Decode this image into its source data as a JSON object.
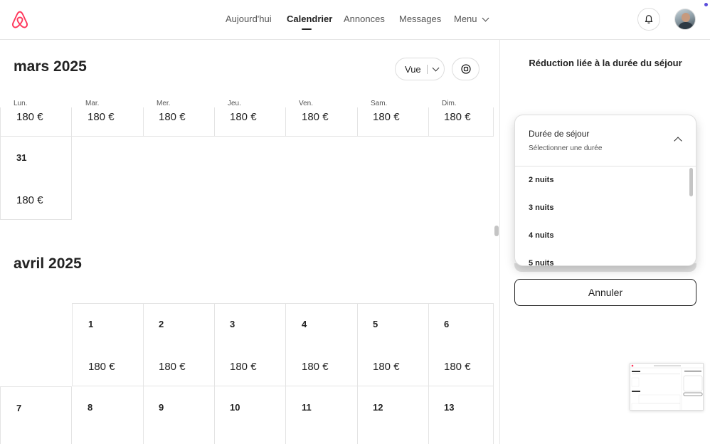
{
  "header": {
    "nav": [
      {
        "label": "Aujourd'hui",
        "active": false
      },
      {
        "label": "Calendrier",
        "active": true
      },
      {
        "label": "Annonces",
        "active": false
      },
      {
        "label": "Messages",
        "active": false
      },
      {
        "label": "Menu",
        "active": false
      }
    ],
    "icons": [
      "airbnb-logo",
      "bell-icon",
      "avatar"
    ],
    "brand_color": "#FF385C"
  },
  "calendar": {
    "controls": {
      "view_label": "Vue"
    },
    "weekdays": [
      "Lun.",
      "Mar.",
      "Mer.",
      "Jeu.",
      "Ven.",
      "Sam.",
      "Dim."
    ],
    "march": {
      "title": "mars 2025",
      "week_prices": [
        "180 €",
        "180 €",
        "180 €",
        "180 €",
        "180 €",
        "180 €",
        "180 €"
      ],
      "last_day": {
        "day": "31",
        "price": "180 €"
      }
    },
    "april": {
      "title": "avril 2025",
      "week1": [
        {
          "day": "1",
          "price": "180 €"
        },
        {
          "day": "2",
          "price": "180 €"
        },
        {
          "day": "3",
          "price": "180 €"
        },
        {
          "day": "4",
          "price": "180 €"
        },
        {
          "day": "5",
          "price": "180 €"
        },
        {
          "day": "6",
          "price": "180 €"
        }
      ],
      "week2": [
        "7",
        "8",
        "9",
        "10",
        "11",
        "12",
        "13"
      ]
    }
  },
  "panel": {
    "title": "Réduction liée à la durée du séjour",
    "dropdown": {
      "label": "Durée de séjour",
      "placeholder": "Sélectionner une durée",
      "options": [
        "2 nuits",
        "3 nuits",
        "4 nuits",
        "5 nuits"
      ]
    },
    "cancel_label": "Annuler"
  }
}
